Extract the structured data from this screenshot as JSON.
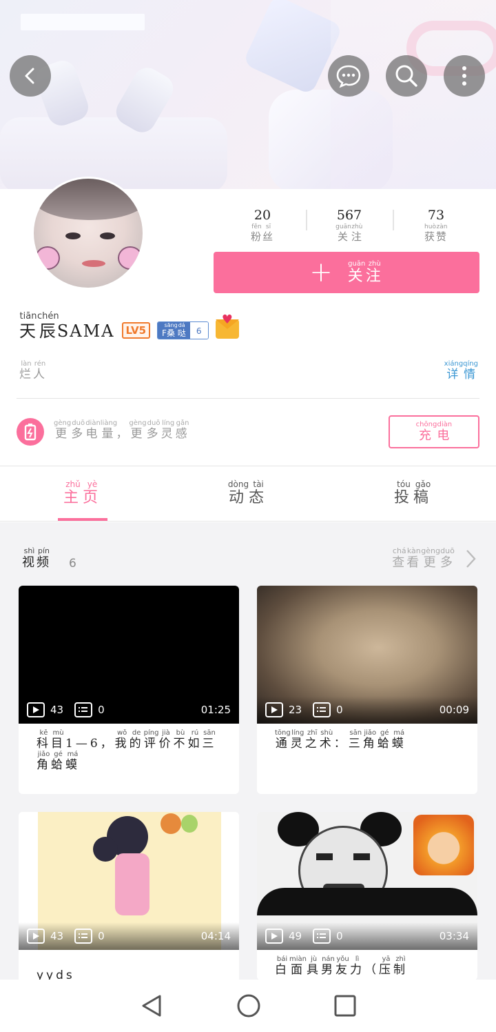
{
  "header": {
    "back_icon": "chevron-left-icon",
    "message_icon": "chat-bubble-icon",
    "search_icon": "search-icon",
    "more_icon": "more-vertical-icon"
  },
  "profile": {
    "stats": [
      {
        "value": "20",
        "label": "粉丝",
        "pinyin": [
          "fěn",
          "sī"
        ]
      },
      {
        "value": "567",
        "label": "关注",
        "pinyin": [
          "guān",
          "zhù"
        ]
      },
      {
        "value": "73",
        "label": "获赞",
        "pinyin": [
          "huò",
          "zàn"
        ]
      }
    ],
    "follow_button": {
      "label": "关注",
      "pinyin": [
        "guān",
        "zhù"
      ]
    },
    "username_cn": "天辰",
    "username_pinyin": [
      "tiān",
      "chén"
    ],
    "username_latin": "SAMA",
    "level_badge": "LV5",
    "fan_badge_label": "F桑哒",
    "fan_badge_pinyin": [
      "sāng",
      "dá"
    ],
    "fan_badge_level": "6",
    "signature": "烂人",
    "signature_pinyin": [
      "làn",
      "rén"
    ],
    "detail_link": "详情",
    "detail_pinyin": [
      "xiáng",
      "qíng"
    ],
    "charge_prompt": [
      "更",
      "多",
      "电",
      "量",
      "，",
      "更",
      "多",
      "灵",
      "感"
    ],
    "charge_prompt_pinyin": [
      "gèng",
      "duō",
      "diàn",
      "liàng",
      "",
      "gèng",
      "duō",
      "líng",
      "gǎn"
    ],
    "charge_button": "充电",
    "charge_button_pinyin": [
      "chōng",
      "diàn"
    ]
  },
  "tabs": [
    {
      "label": "主页",
      "pinyin": [
        "zhǔ",
        "yè"
      ],
      "active": true
    },
    {
      "label": "动态",
      "pinyin": [
        "dòng",
        "tài"
      ],
      "active": false
    },
    {
      "label": "投稿",
      "pinyin": [
        "tóu",
        "gǎo"
      ],
      "active": false
    }
  ],
  "videos_section": {
    "title": "视频",
    "title_pinyin": [
      "shì",
      "pín"
    ],
    "count": "6",
    "more": "查看更多",
    "more_pinyin": [
      "chá",
      "kàn",
      "gèng",
      "duō"
    ]
  },
  "videos": [
    {
      "plays": "43",
      "comments": "0",
      "duration": "01:25",
      "title_chars": [
        "科",
        "目",
        "1—6",
        "，",
        "我",
        "的",
        "评",
        "价",
        "不",
        "如",
        "三",
        "角",
        "蛤",
        "蟆"
      ],
      "title_pinyin": [
        "kē",
        "mù",
        "",
        "",
        "wǒ",
        "de",
        "píng",
        "jià",
        "bù",
        "rú",
        "sān",
        "jiǎo",
        "gé",
        "má"
      ]
    },
    {
      "plays": "23",
      "comments": "0",
      "duration": "00:09",
      "title_chars": [
        "通",
        "灵",
        "之",
        "术",
        "：",
        "三",
        "角",
        "蛤",
        "蟆"
      ],
      "title_pinyin": [
        "tōng",
        "líng",
        "zhī",
        "shù",
        "",
        "sān",
        "jiǎo",
        "gé",
        "má"
      ]
    },
    {
      "plays": "43",
      "comments": "0",
      "duration": "04:14",
      "title_chars": [
        "yyds"
      ],
      "title_pinyin": [
        ""
      ]
    },
    {
      "plays": "49",
      "comments": "0",
      "duration": "03:34",
      "title_chars": [
        "白",
        "面",
        "具",
        "男",
        "友",
        "力",
        "（",
        "压",
        "制"
      ],
      "title_pinyin": [
        "bái",
        "miàn",
        "jù",
        "nán",
        "yǒu",
        "lì",
        "",
        "yā",
        "zhì"
      ]
    }
  ],
  "colors": {
    "accent": "#fb6f9c",
    "link": "#3b97d3",
    "level": "#f07a2c",
    "fan_badge": "#4d79c2"
  },
  "navbar": {
    "back": "triangle-back-icon",
    "home": "circle-home-icon",
    "recents": "square-recents-icon"
  }
}
